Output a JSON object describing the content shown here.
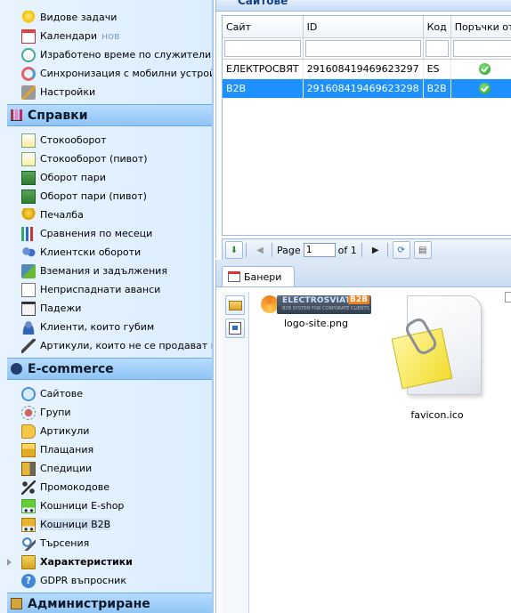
{
  "sidebar": {
    "top_items": [
      {
        "label": "Видове задачи",
        "icon": "lightbulb-icon"
      },
      {
        "label": "Календари",
        "badge": "нов",
        "icon": "calendar-icon"
      },
      {
        "label": "Изработено време по служители",
        "icon": "clock-icon"
      },
      {
        "label": "Синхронизация с мобилни устрой",
        "icon": "sync-icon"
      },
      {
        "label": "Настройки",
        "icon": "tools-icon"
      }
    ],
    "reports_header": "Справки",
    "reports_items": [
      {
        "label": "Стокооборот",
        "icon": "report-icon"
      },
      {
        "label": "Стокооборот (пивот)",
        "icon": "report-icon"
      },
      {
        "label": "Оборот пари",
        "icon": "money-icon"
      },
      {
        "label": "Оборот пари (пивот)",
        "icon": "money-icon"
      },
      {
        "label": "Печалба",
        "icon": "trophy-icon"
      },
      {
        "label": "Сравнения по месеци",
        "icon": "bar-chart-icon"
      },
      {
        "label": "Клиентски обороти",
        "icon": "users-icon"
      },
      {
        "label": "Вземания и задължения",
        "icon": "exchange-icon"
      },
      {
        "label": "Неприспаднати аванси",
        "icon": "document-icon"
      },
      {
        "label": "Падежи",
        "icon": "calendar-icon"
      },
      {
        "label": "Клиенти, които губим",
        "icon": "person-icon"
      },
      {
        "label": "Артикули, които не се продават в",
        "icon": "pen-icon"
      }
    ],
    "ecommerce_header": "E-commerce",
    "ecommerce_items": [
      {
        "label": "Сайтове",
        "icon": "globe-icon"
      },
      {
        "label": "Групи",
        "icon": "groups-icon"
      },
      {
        "label": "Артикули",
        "icon": "tag-icon"
      },
      {
        "label": "Плащания",
        "icon": "card-icon"
      },
      {
        "label": "Спедиции",
        "icon": "truck-icon"
      },
      {
        "label": "Промокодове",
        "icon": "percent-icon"
      },
      {
        "label": "Кошници E-shop",
        "icon": "cart-icon"
      },
      {
        "label": "Кошници B2B",
        "icon": "cart-b2b-icon",
        "selected": true
      },
      {
        "label": "Търсения",
        "icon": "search-icon"
      },
      {
        "label": "Характеристики",
        "icon": "folder-icon",
        "bold": true,
        "expandable": true
      },
      {
        "label": "GDPR въпросник",
        "icon": "help-icon"
      }
    ],
    "admin_header": "Администриране"
  },
  "sites_panel": {
    "title": "Сайтове",
    "columns": [
      "Сайт",
      "ID",
      "Код",
      "Поръчки от"
    ],
    "rows": [
      {
        "site": "ЕЛЕКТРОСВЯТ",
        "id": "291608419469623297",
        "code": "ES",
        "orders_enabled": true
      },
      {
        "site": "B2B",
        "id": "291608419469623298",
        "code": "B2B",
        "orders_enabled": true,
        "selected": true
      }
    ],
    "pager": {
      "page_label": "Page",
      "page_value": "1",
      "of_label": "of 1"
    }
  },
  "banners_panel": {
    "tab_label": "Банери",
    "files": [
      {
        "name": "logo-site.png",
        "logo_brand": "ELECTROSVIAT",
        "logo_badge": "B2B",
        "logo_tagline": "B2B SYSTEM FOR CORPORATE CLIENTS"
      },
      {
        "name": "favicon.ico"
      }
    ]
  },
  "colors": {
    "selected_row": "#1e90ff",
    "section_header": "#8fc4f4",
    "sidebar_bg": "#dcedff"
  }
}
